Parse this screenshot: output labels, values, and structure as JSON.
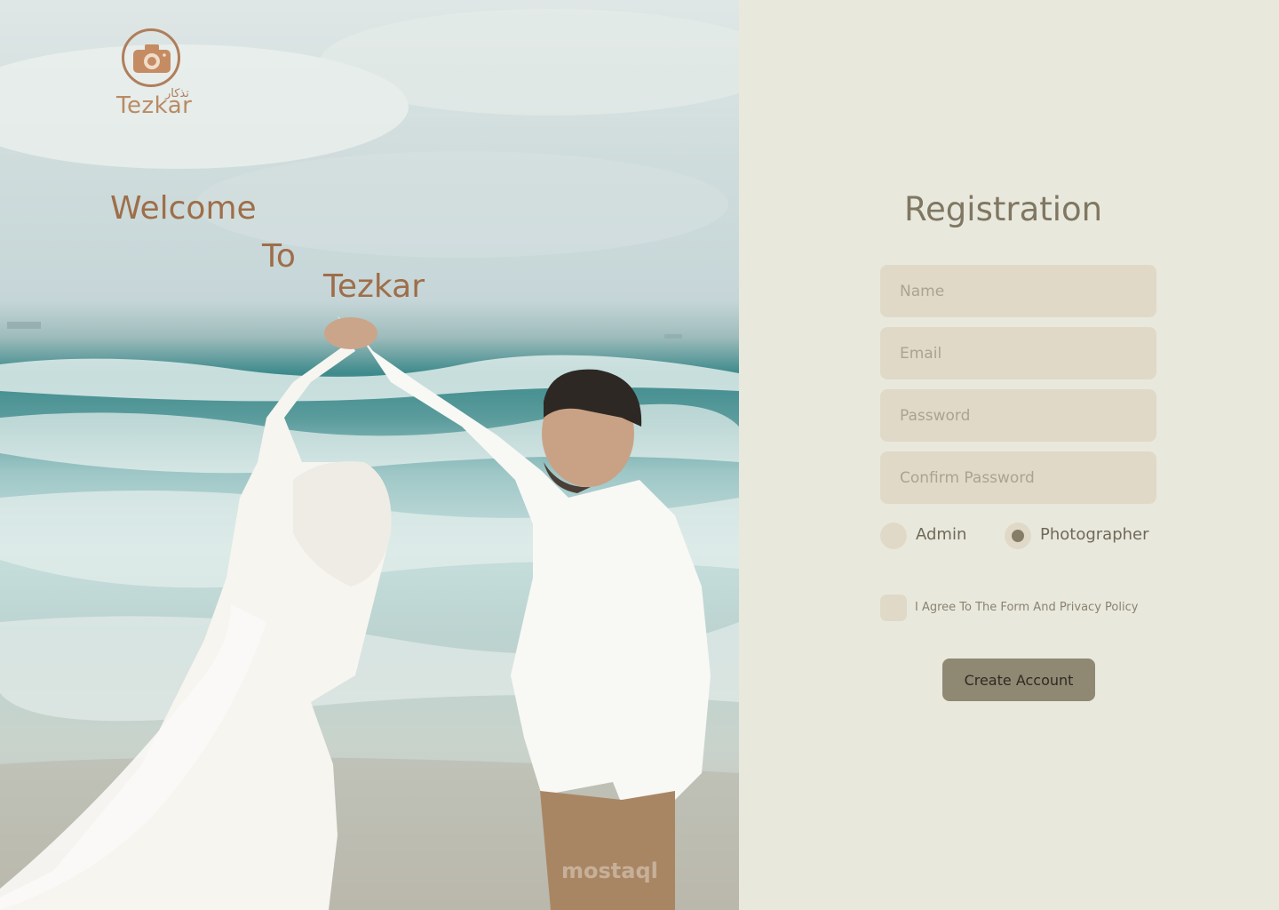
{
  "brand": {
    "name": "Tezkar",
    "name_arabic": "تذكار",
    "logo_icon": "camera-icon",
    "color": "#b07e5a"
  },
  "hero": {
    "line1": "Welcome",
    "line2": "To",
    "line3": "Tezkar",
    "watermark": "mostaql"
  },
  "form": {
    "title": "Registration",
    "fields": {
      "name": {
        "placeholder": "Name",
        "value": ""
      },
      "email": {
        "placeholder": "Email",
        "value": ""
      },
      "password": {
        "placeholder": "Password",
        "value": ""
      },
      "confirm_password": {
        "placeholder": "Confirm Password",
        "value": ""
      }
    },
    "roles": [
      {
        "label": "Admin",
        "selected": false
      },
      {
        "label": "Photographer",
        "selected": true
      }
    ],
    "agree_label": "I Agree To The Form And Privacy Policy",
    "agree_checked": false,
    "submit_label": "Create Account"
  },
  "colors": {
    "panel_bg": "#e9e8dd",
    "field_bg": "#e0d9c8",
    "button_bg": "#8f8873",
    "title": "#7f7762",
    "hero_text": "#9e6e4a"
  }
}
